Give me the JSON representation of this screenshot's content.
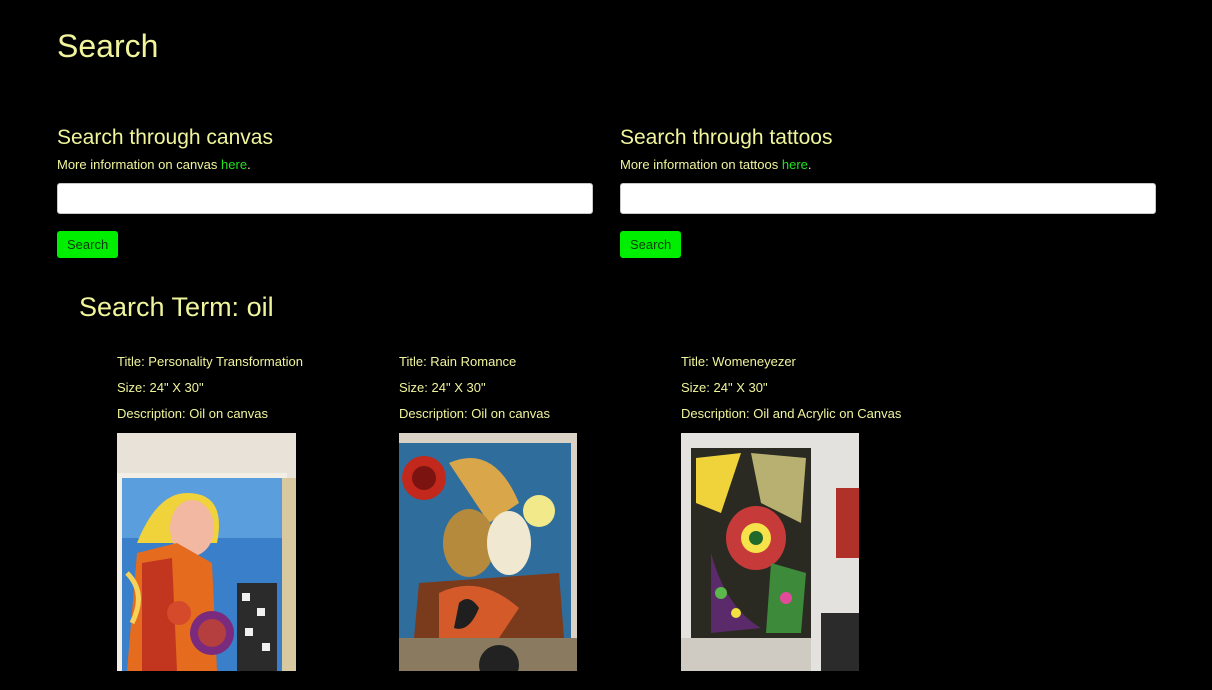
{
  "page": {
    "title": "Search"
  },
  "canvas_search": {
    "heading": "Search through canvas",
    "info_prefix": "More information on canvas ",
    "info_link": "here",
    "info_suffix": ".",
    "input_value": "",
    "button_label": "Search"
  },
  "tattoo_search": {
    "heading": "Search through tattoos",
    "info_prefix": "More information on tattoos ",
    "info_link": "here",
    "info_suffix": ".",
    "input_value": "",
    "button_label": "Search"
  },
  "results": {
    "heading": "Search Term: oil",
    "items": [
      {
        "title": "Title: Personality Transformation",
        "size": "Size: 24\" X 30\"",
        "description": "Description: Oil on canvas"
      },
      {
        "title": "Title: Rain Romance",
        "size": "Size: 24\" X 30\"",
        "description": "Description: Oil on canvas"
      },
      {
        "title": "Title: Womeneyezer",
        "size": "Size: 24\" X 30\"",
        "description": "Description: Oil and Acrylic on Canvas"
      }
    ]
  },
  "colors": {
    "background": "#000000",
    "text": "#f0f59b",
    "link": "#22e022",
    "button": "#00ee00"
  }
}
